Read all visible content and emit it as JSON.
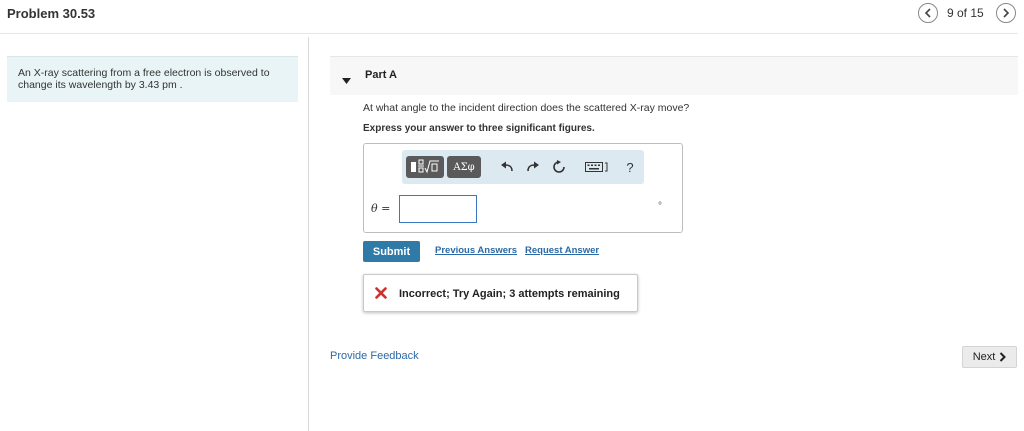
{
  "header": {
    "title": "Problem 30.53",
    "pager": "9 of 15"
  },
  "problem": {
    "text": "An X-ray scattering from a free electron is observed to change its wavelength by 3.43 pm ."
  },
  "part": {
    "label": "Part A",
    "question": "At what angle to the incident direction does the scattered X-ray move?",
    "instruction": "Express your answer to three significant figures."
  },
  "answer": {
    "variable": "θ =",
    "value": "",
    "unit": "°",
    "toolbar": {
      "greek_label": "ΑΣφ",
      "help_label": "?"
    }
  },
  "actions": {
    "submit_label": "Submit",
    "previous_answers_label": "Previous Answers",
    "request_answer_label": "Request Answer"
  },
  "feedback": {
    "message": "Incorrect; Try Again; 3 attempts remaining",
    "status_color": "#d0312d"
  },
  "footer": {
    "provide_feedback_label": "Provide Feedback",
    "next_label": "Next"
  },
  "colors": {
    "accent": "#2f7aa6",
    "link": "#2b6aa6",
    "problem_bg": "#e9f4f6"
  }
}
